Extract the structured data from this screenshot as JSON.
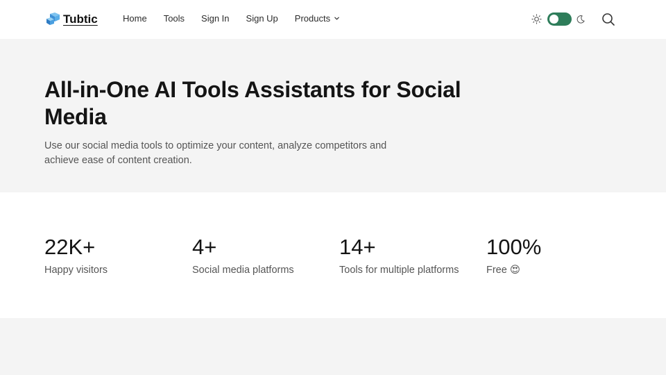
{
  "header": {
    "logo_text": "Tubtic",
    "nav": {
      "home": "Home",
      "tools": "Tools",
      "sign_in": "Sign In",
      "sign_up": "Sign Up",
      "products": "Products"
    },
    "theme_toggle": {
      "state": "on",
      "color": "#2e7d5a"
    }
  },
  "hero": {
    "title": "All-in-One AI Tools Assistants for Social Media",
    "subtitle": "Use our social media tools to optimize your content, analyze competitors and achieve ease of content creation."
  },
  "stats": [
    {
      "value": "22K+",
      "label": "Happy visitors"
    },
    {
      "value": "4+",
      "label": "Social media platforms"
    },
    {
      "value": "14+",
      "label": "Tools for multiple platforms"
    },
    {
      "value": "100%",
      "label": "Free 😍"
    }
  ]
}
